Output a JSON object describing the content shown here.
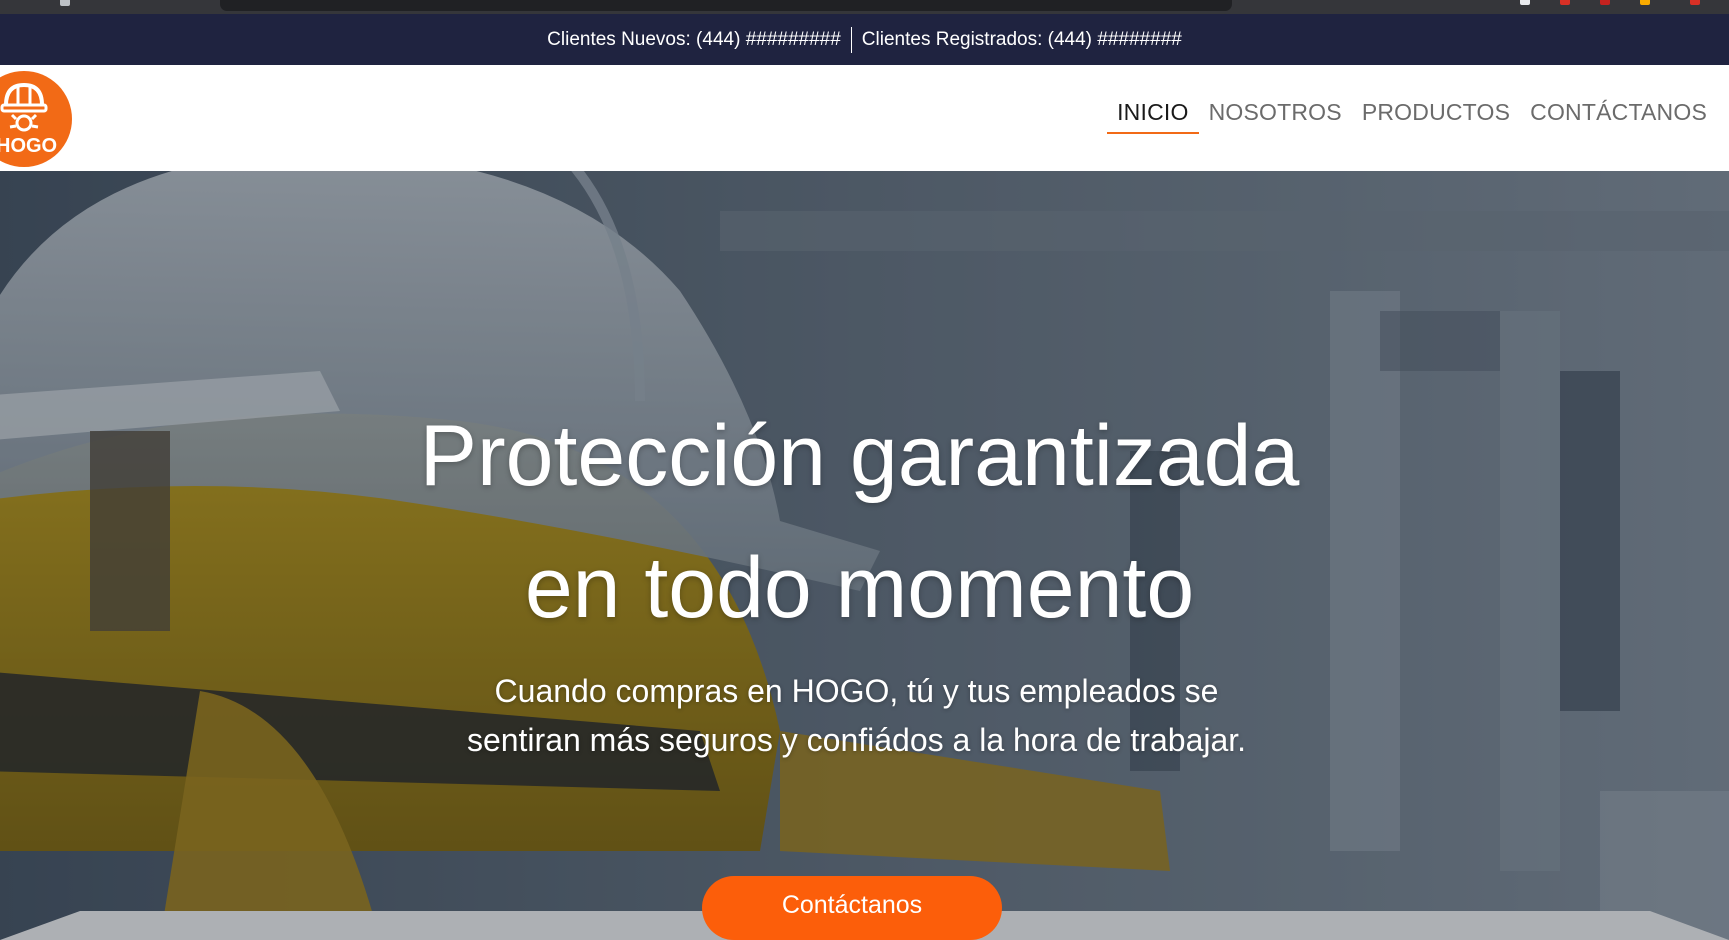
{
  "topbar": {
    "new_clients": "Clientes Nuevos: (444) #########",
    "registered_clients": "Clientes Registrados: (444) ########"
  },
  "brand": {
    "logo_text": "HOGO",
    "color": "#f26a16"
  },
  "nav": {
    "items": [
      {
        "label": "INICIO",
        "active": true
      },
      {
        "label": "NOSOTROS",
        "active": false
      },
      {
        "label": "PRODUCTOS",
        "active": false
      },
      {
        "label": "CONTÁCTANOS",
        "active": false
      }
    ]
  },
  "hero": {
    "title_line1": "Protección garantizada",
    "title_line2": "en todo momento",
    "subtitle_line1": "Cuando compras en HOGO, tú y tus empleados se",
    "subtitle_line2": "sentiran más seguros y confiádos a la hora de trabajar.",
    "cta_label": "Contáctanos",
    "cta_color": "#fc5e0a"
  },
  "colors": {
    "topbar_bg": "#1f2340",
    "nav_active_underline": "#f26a16"
  }
}
